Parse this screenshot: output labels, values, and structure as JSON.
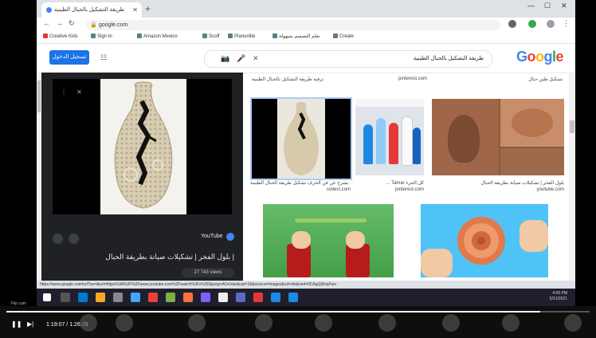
{
  "browser": {
    "tab_title": "طريقة التشكيل بالحبال الطينية",
    "url": "google.com",
    "bookmarks": [
      "Creative Kids",
      "Sign In",
      "Amazon Mexico",
      "Scoff",
      "Planunlite",
      "تعلم التصميم بسهولة",
      "Create"
    ]
  },
  "google": {
    "signin_label": "تسجيل الدخول",
    "query": "طريقة التشكيل بالحبال الطينية",
    "logo": "Google"
  },
  "viewer": {
    "site": "YouTube",
    "title": "بلول الفخر | تشكيلات صيانة بطريقة الحبال |",
    "visit": "27 743 views"
  },
  "results": {
    "row1_captions": [
      "تعليمي تشكيل صنع خزفية طريقة التشكيل بالحبال الطينية",
      "pinterest.com",
      "تشكيل طين حبال"
    ],
    "row2_captions": [
      "تشكيل... بشرح عن فن الخزف تشكيل طريقة الحبال الطينية",
      "... Tamar كل الجزء",
      "بلول الفخر | تشكيلات صيانة بطريقة الحبال"
    ],
    "row2_subs": [
      "collect.com",
      "pinterest.com",
      "youtube.com"
    ],
    "row3_labels": [
      "",
      ""
    ]
  },
  "status_url": "https://www.google.com/url?sa=i&url=https%3A%2F%2Fwww.youtube.com%2Fwatch%3Fv%3D&psig=AOvVaw&ust=16&source=images&cd=vfe&ved=0CAgQjRxqFwo",
  "taskbar": {
    "time": "4:56 PM",
    "date": "5/21/2021"
  },
  "player": {
    "time": "1:19:07 / 1:26:29",
    "progress": 0.915,
    "corner_label": "Flip cam"
  }
}
